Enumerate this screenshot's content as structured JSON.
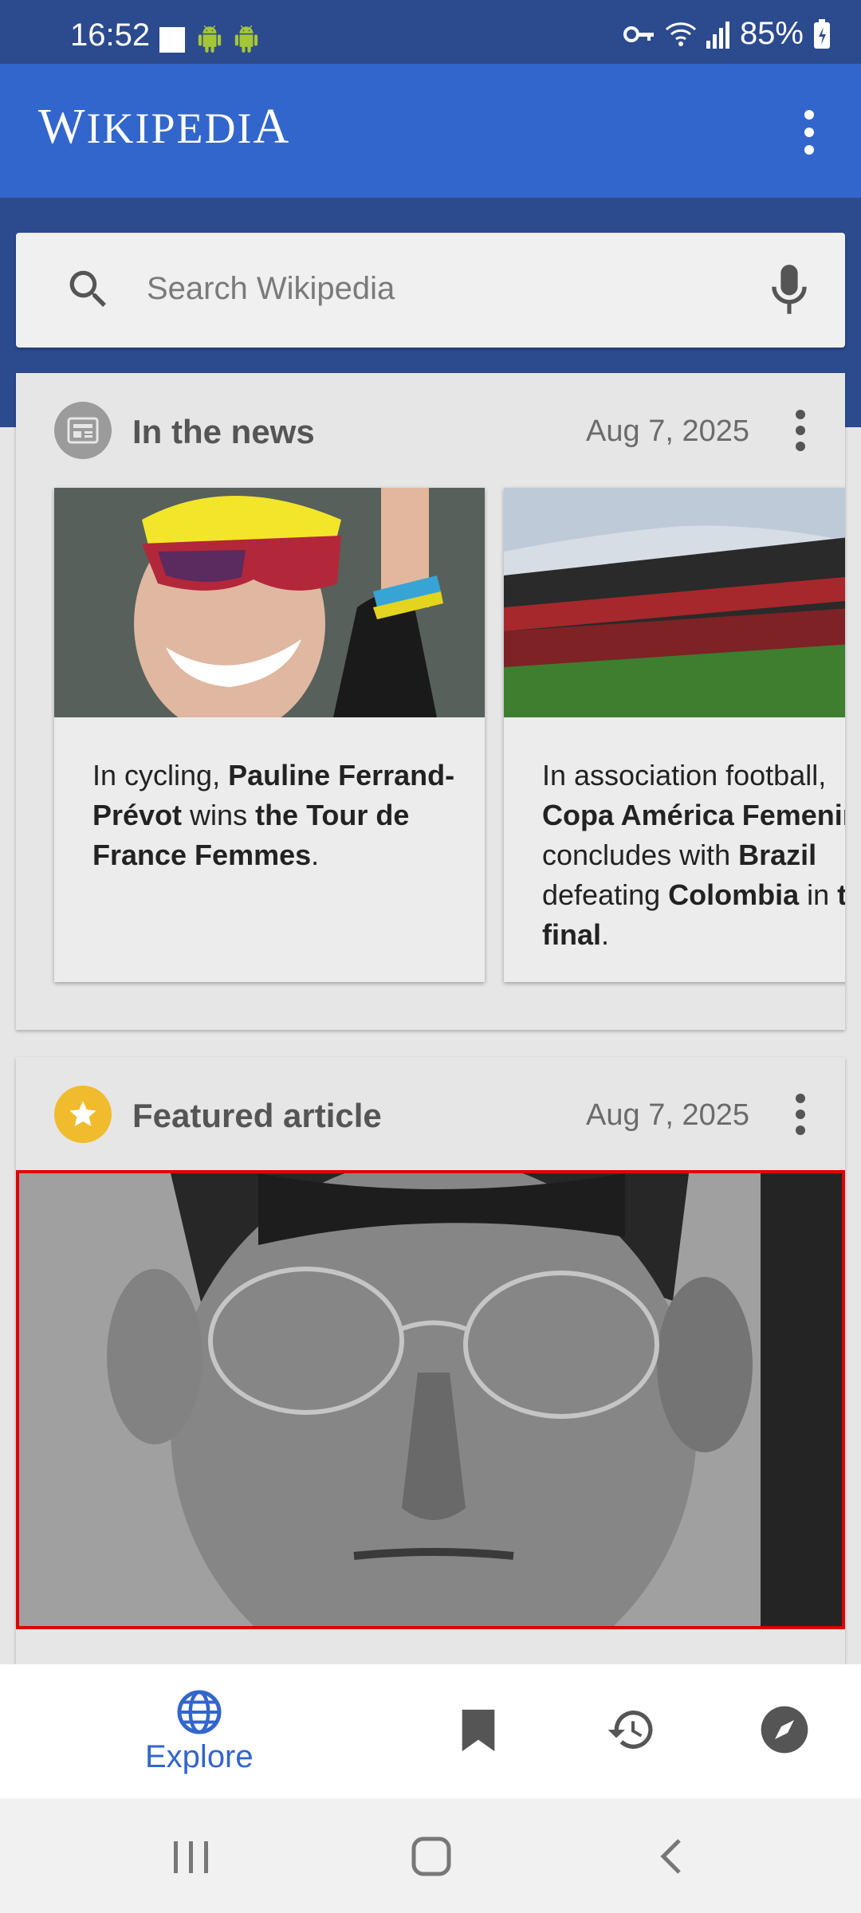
{
  "status_bar": {
    "time": "16:52",
    "battery": "85%"
  },
  "app_bar": {
    "logo_first": "W",
    "logo_middle": "IKIPEDI",
    "logo_last": "A"
  },
  "search": {
    "placeholder": "Search Wikipedia"
  },
  "in_the_news": {
    "title": "In the news",
    "date": "Aug 7, 2025",
    "items": [
      {
        "parts": [
          "In cycling, ",
          "Pauline Ferrand-Prévot",
          " wins ",
          "the Tour de France Femmes",
          "."
        ]
      },
      {
        "parts": [
          "In association football, ",
          "Copa América Femenina",
          " concludes with ",
          "Brazil",
          " defeating ",
          "Colombia",
          " in ",
          "the final",
          "."
        ]
      }
    ]
  },
  "featured_article": {
    "title": "Featured article",
    "date": "Aug 7, 2025"
  },
  "bottom_nav": {
    "explore_label": "Explore"
  },
  "colors": {
    "accent": "#3366cc",
    "status_bar": "#2c4a8e",
    "featured_star": "#f0bc2e"
  }
}
